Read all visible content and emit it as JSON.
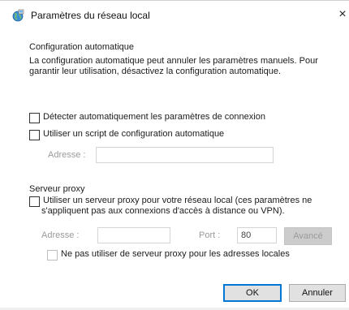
{
  "window": {
    "title": "Paramètres du réseau local",
    "close_glyph": "×",
    "icon": "network-globe-icon"
  },
  "auto_config": {
    "group_label": "Configuration automatique",
    "description_line1": "La configuration automatique peut annuler les paramètres manuels. Pour",
    "description_line2": "garantir leur utilisation, désactivez la configuration automatique.",
    "detect_label": "Détecter automatiquement les paramètres de connexion",
    "detect_checked": false,
    "script_label": "Utiliser un script de configuration automatique",
    "script_checked": false,
    "address_label": "Adresse :",
    "address_value": ""
  },
  "proxy": {
    "group_label": "Serveur proxy",
    "use_proxy_line1": "Utiliser un serveur proxy pour votre réseau local (ces paramètres ne",
    "use_proxy_line2": "s'appliquent pas aux connexions d'accès à distance ou VPN).",
    "use_proxy_checked": false,
    "address_label": "Adresse :",
    "address_value": "",
    "port_label": "Port :",
    "port_value": "80",
    "advanced_label": "Avancé",
    "bypass_label": "Ne pas utiliser de serveur proxy pour les adresses locales",
    "bypass_checked": false
  },
  "buttons": {
    "ok_label": "OK",
    "cancel_label": "Annuler"
  }
}
